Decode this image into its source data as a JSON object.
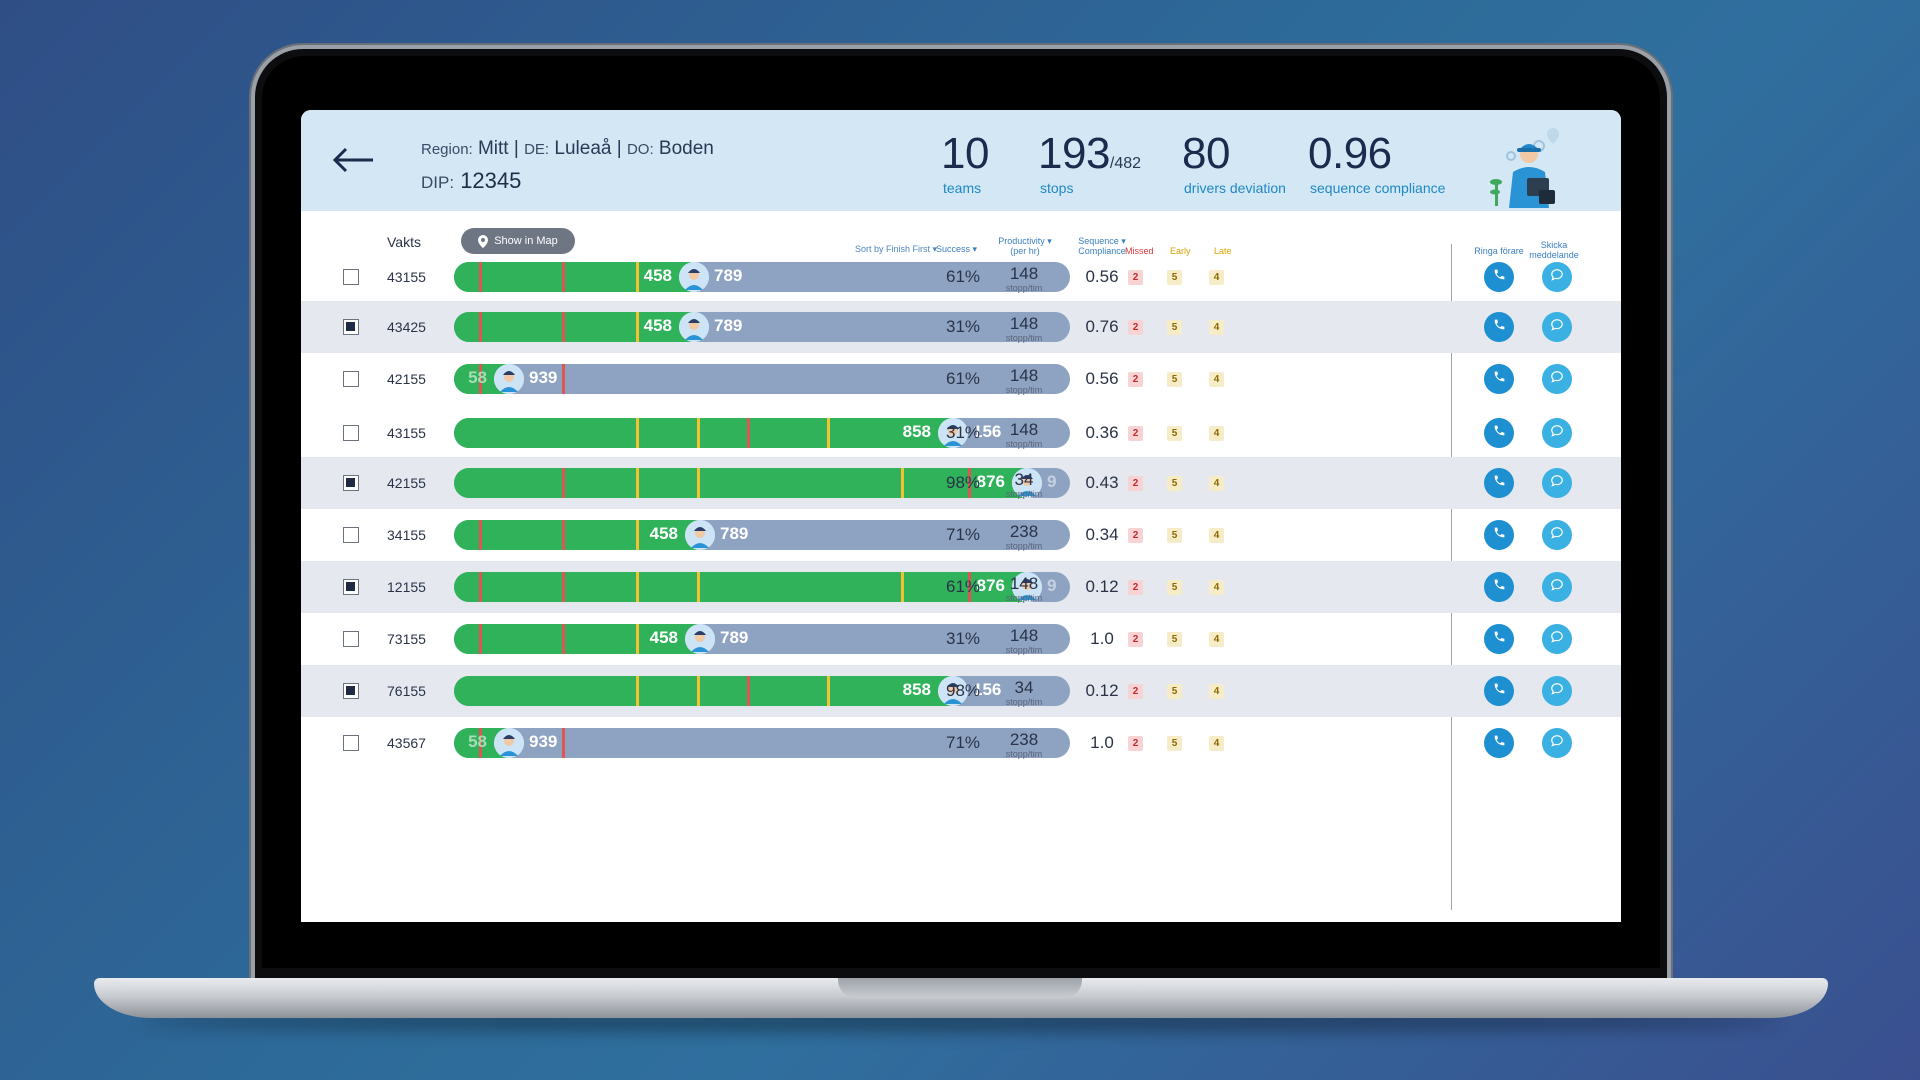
{
  "header": {
    "region_label": "Region:",
    "region": "Mitt",
    "de_label": "DE:",
    "de": "Luleaå",
    "do_label": "DO:",
    "do": "Boden",
    "dip_label": "DIP:",
    "dip": "12345",
    "sep": "|"
  },
  "kpis": {
    "teams": {
      "value": "10",
      "caption": "teams"
    },
    "stops": {
      "value": "193",
      "total": "/482",
      "caption": "stops"
    },
    "deviation": {
      "value": "80",
      "caption": "drivers deviation"
    },
    "compliance": {
      "value": "0.96",
      "caption": "sequence compliance"
    }
  },
  "toolbar": {
    "vakts_label": "Vakts",
    "map_button": "Show in Map"
  },
  "columns": {
    "sort": "Sort by Finish First ▾",
    "success": "Success ▾",
    "productivity": "Productivity ▾",
    "productivity_sub": "(per hr)",
    "sequence": "Sequence ▾",
    "sequence_sub": "Compliance",
    "missed": "Missed",
    "early": "Early",
    "late": "Late",
    "call": "Ringa förare",
    "message_1": "Skicka",
    "message_2": "meddelande"
  },
  "colors": {
    "done": "#2fb25a",
    "remaining": "#8ea3c2",
    "missed_tick": "#e05454",
    "late_tick": "#f2c230",
    "call": "#1e8fd0",
    "message": "#3ab0e3"
  },
  "rows": [
    {
      "id": "43155",
      "checked": false,
      "done": "458",
      "remaining": "789",
      "progress": 0.39,
      "success": "61%",
      "prod": "148",
      "prod_unit": "stopp/tim",
      "seq": "0.56",
      "missed": "2",
      "early": "5",
      "late": "4",
      "ticks": [
        {
          "pos": 0.04,
          "kind": "red"
        },
        {
          "pos": 0.175,
          "kind": "red"
        },
        {
          "pos": 0.295,
          "kind": "yel"
        }
      ]
    },
    {
      "id": "43425",
      "checked": true,
      "done": "458",
      "remaining": "789",
      "progress": 0.39,
      "success": "31%",
      "prod": "148",
      "prod_unit": "stopp/tim",
      "seq": "0.76",
      "missed": "2",
      "early": "5",
      "late": "4",
      "ticks": [
        {
          "pos": 0.04,
          "kind": "red"
        },
        {
          "pos": 0.175,
          "kind": "red"
        },
        {
          "pos": 0.295,
          "kind": "yel"
        }
      ]
    },
    {
      "id": "42155",
      "checked": false,
      "done": "58",
      "remaining": "939",
      "progress": 0.09,
      "success": "61%",
      "prod": "148",
      "prod_unit": "stopp/tim",
      "seq": "0.56",
      "missed": "2",
      "early": "5",
      "late": "4",
      "ticks": [
        {
          "pos": 0.04,
          "kind": "red"
        },
        {
          "pos": 0.175,
          "kind": "red"
        }
      ]
    },
    {
      "id": "43155",
      "checked": false,
      "done": "858",
      "remaining": "156",
      "progress": 0.81,
      "success": "31%",
      "prod": "148",
      "prod_unit": "stopp/tim",
      "seq": "0.36",
      "missed": "2",
      "early": "5",
      "late": "4",
      "ticks": [
        {
          "pos": 0.295,
          "kind": "yel"
        },
        {
          "pos": 0.395,
          "kind": "yel"
        },
        {
          "pos": 0.475,
          "kind": "red"
        },
        {
          "pos": 0.605,
          "kind": "yel"
        }
      ]
    },
    {
      "id": "42155",
      "checked": true,
      "done": "876",
      "remaining": "9",
      "progress": 0.93,
      "success": "98%",
      "prod": "34",
      "prod_unit": "stopp/tim",
      "seq": "0.43",
      "missed": "2",
      "early": "5",
      "late": "4",
      "ticks": [
        {
          "pos": 0.175,
          "kind": "red"
        },
        {
          "pos": 0.295,
          "kind": "yel"
        },
        {
          "pos": 0.395,
          "kind": "yel"
        },
        {
          "pos": 0.725,
          "kind": "yel"
        },
        {
          "pos": 0.835,
          "kind": "red"
        }
      ]
    },
    {
      "id": "34155",
      "checked": false,
      "done": "458",
      "remaining": "789",
      "progress": 0.4,
      "success": "71%",
      "prod": "238",
      "prod_unit": "stopp/tim",
      "seq": "0.34",
      "missed": "2",
      "early": "5",
      "late": "4",
      "ticks": [
        {
          "pos": 0.04,
          "kind": "red"
        },
        {
          "pos": 0.175,
          "kind": "red"
        },
        {
          "pos": 0.295,
          "kind": "yel"
        }
      ]
    },
    {
      "id": "12155",
      "checked": true,
      "done": "876",
      "remaining": "9",
      "progress": 0.93,
      "success": "61%",
      "prod": "148",
      "prod_unit": "stopp/tim",
      "seq": "0.12",
      "missed": "2",
      "early": "5",
      "late": "4",
      "ticks": [
        {
          "pos": 0.04,
          "kind": "red"
        },
        {
          "pos": 0.175,
          "kind": "red"
        },
        {
          "pos": 0.295,
          "kind": "yel"
        },
        {
          "pos": 0.395,
          "kind": "yel"
        },
        {
          "pos": 0.725,
          "kind": "yel"
        },
        {
          "pos": 0.835,
          "kind": "red"
        }
      ]
    },
    {
      "id": "73155",
      "checked": false,
      "done": "458",
      "remaining": "789",
      "progress": 0.4,
      "success": "31%",
      "prod": "148",
      "prod_unit": "stopp/tim",
      "seq": "1.0",
      "missed": "2",
      "early": "5",
      "late": "4",
      "ticks": [
        {
          "pos": 0.04,
          "kind": "red"
        },
        {
          "pos": 0.175,
          "kind": "red"
        },
        {
          "pos": 0.295,
          "kind": "yel"
        }
      ]
    },
    {
      "id": "76155",
      "checked": true,
      "done": "858",
      "remaining": "156",
      "progress": 0.81,
      "success": "98%",
      "prod": "34",
      "prod_unit": "stopp/tim",
      "seq": "0.12",
      "missed": "2",
      "early": "5",
      "late": "4",
      "ticks": [
        {
          "pos": 0.295,
          "kind": "yel"
        },
        {
          "pos": 0.395,
          "kind": "yel"
        },
        {
          "pos": 0.475,
          "kind": "red"
        },
        {
          "pos": 0.605,
          "kind": "yel"
        }
      ]
    },
    {
      "id": "43567",
      "checked": false,
      "done": "58",
      "remaining": "939",
      "progress": 0.09,
      "success": "71%",
      "prod": "238",
      "prod_unit": "stopp/tim",
      "seq": "1.0",
      "missed": "2",
      "early": "5",
      "late": "4",
      "ticks": [
        {
          "pos": 0.04,
          "kind": "red"
        },
        {
          "pos": 0.175,
          "kind": "red"
        }
      ]
    }
  ]
}
